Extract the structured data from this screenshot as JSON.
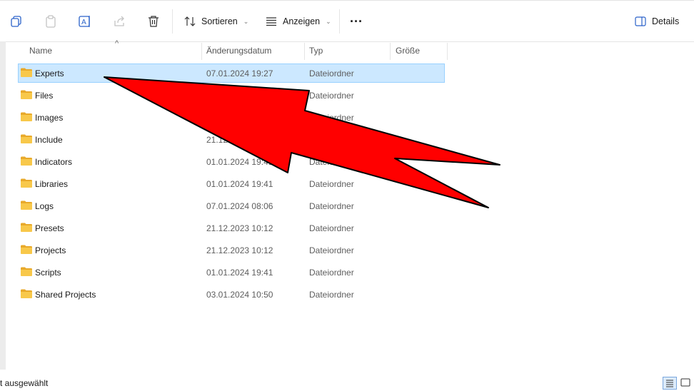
{
  "toolbar": {
    "sort_label": "Sortieren",
    "view_label": "Anzeigen",
    "more_label": "···",
    "details_label": "Details"
  },
  "columns": {
    "name": "Name",
    "date": "Änderungsdatum",
    "type": "Typ",
    "size": "Größe"
  },
  "rows": [
    {
      "name": "Experts",
      "date": "07.01.2024 19:27",
      "type": "Dateiordner",
      "selected": true
    },
    {
      "name": "Files",
      "date": "",
      "type": "Dateiordner"
    },
    {
      "name": "Images",
      "date": "",
      "type": "Dateiordner"
    },
    {
      "name": "Include",
      "date": "21.12.",
      "type": ""
    },
    {
      "name": "Indicators",
      "date": "01.01.2024 19:41",
      "type": "Dateiordner"
    },
    {
      "name": "Libraries",
      "date": "01.01.2024 19:41",
      "type": "Dateiordner"
    },
    {
      "name": "Logs",
      "date": "07.01.2024 08:06",
      "type": "Dateiordner"
    },
    {
      "name": "Presets",
      "date": "21.12.2023 10:12",
      "type": "Dateiordner"
    },
    {
      "name": "Projects",
      "date": "21.12.2023 10:12",
      "type": "Dateiordner"
    },
    {
      "name": "Scripts",
      "date": "01.01.2024 19:41",
      "type": "Dateiordner"
    },
    {
      "name": "Shared Projects",
      "date": "03.01.2024 10:50",
      "type": "Dateiordner"
    }
  ],
  "status": {
    "text": "t ausgewählt"
  },
  "colors": {
    "selection_bg": "#cce8ff",
    "selection_border": "#99d1ff",
    "folder_yellow": "#f8c84a",
    "annotation_arrow": "#ff0000"
  },
  "icons": [
    "copy-icon",
    "paste-icon",
    "rename-icon",
    "share-icon",
    "delete-icon",
    "sort-icon",
    "view-icon",
    "more-icon",
    "details-pane-icon",
    "folder-icon",
    "details-view-icon",
    "tiles-view-icon"
  ]
}
